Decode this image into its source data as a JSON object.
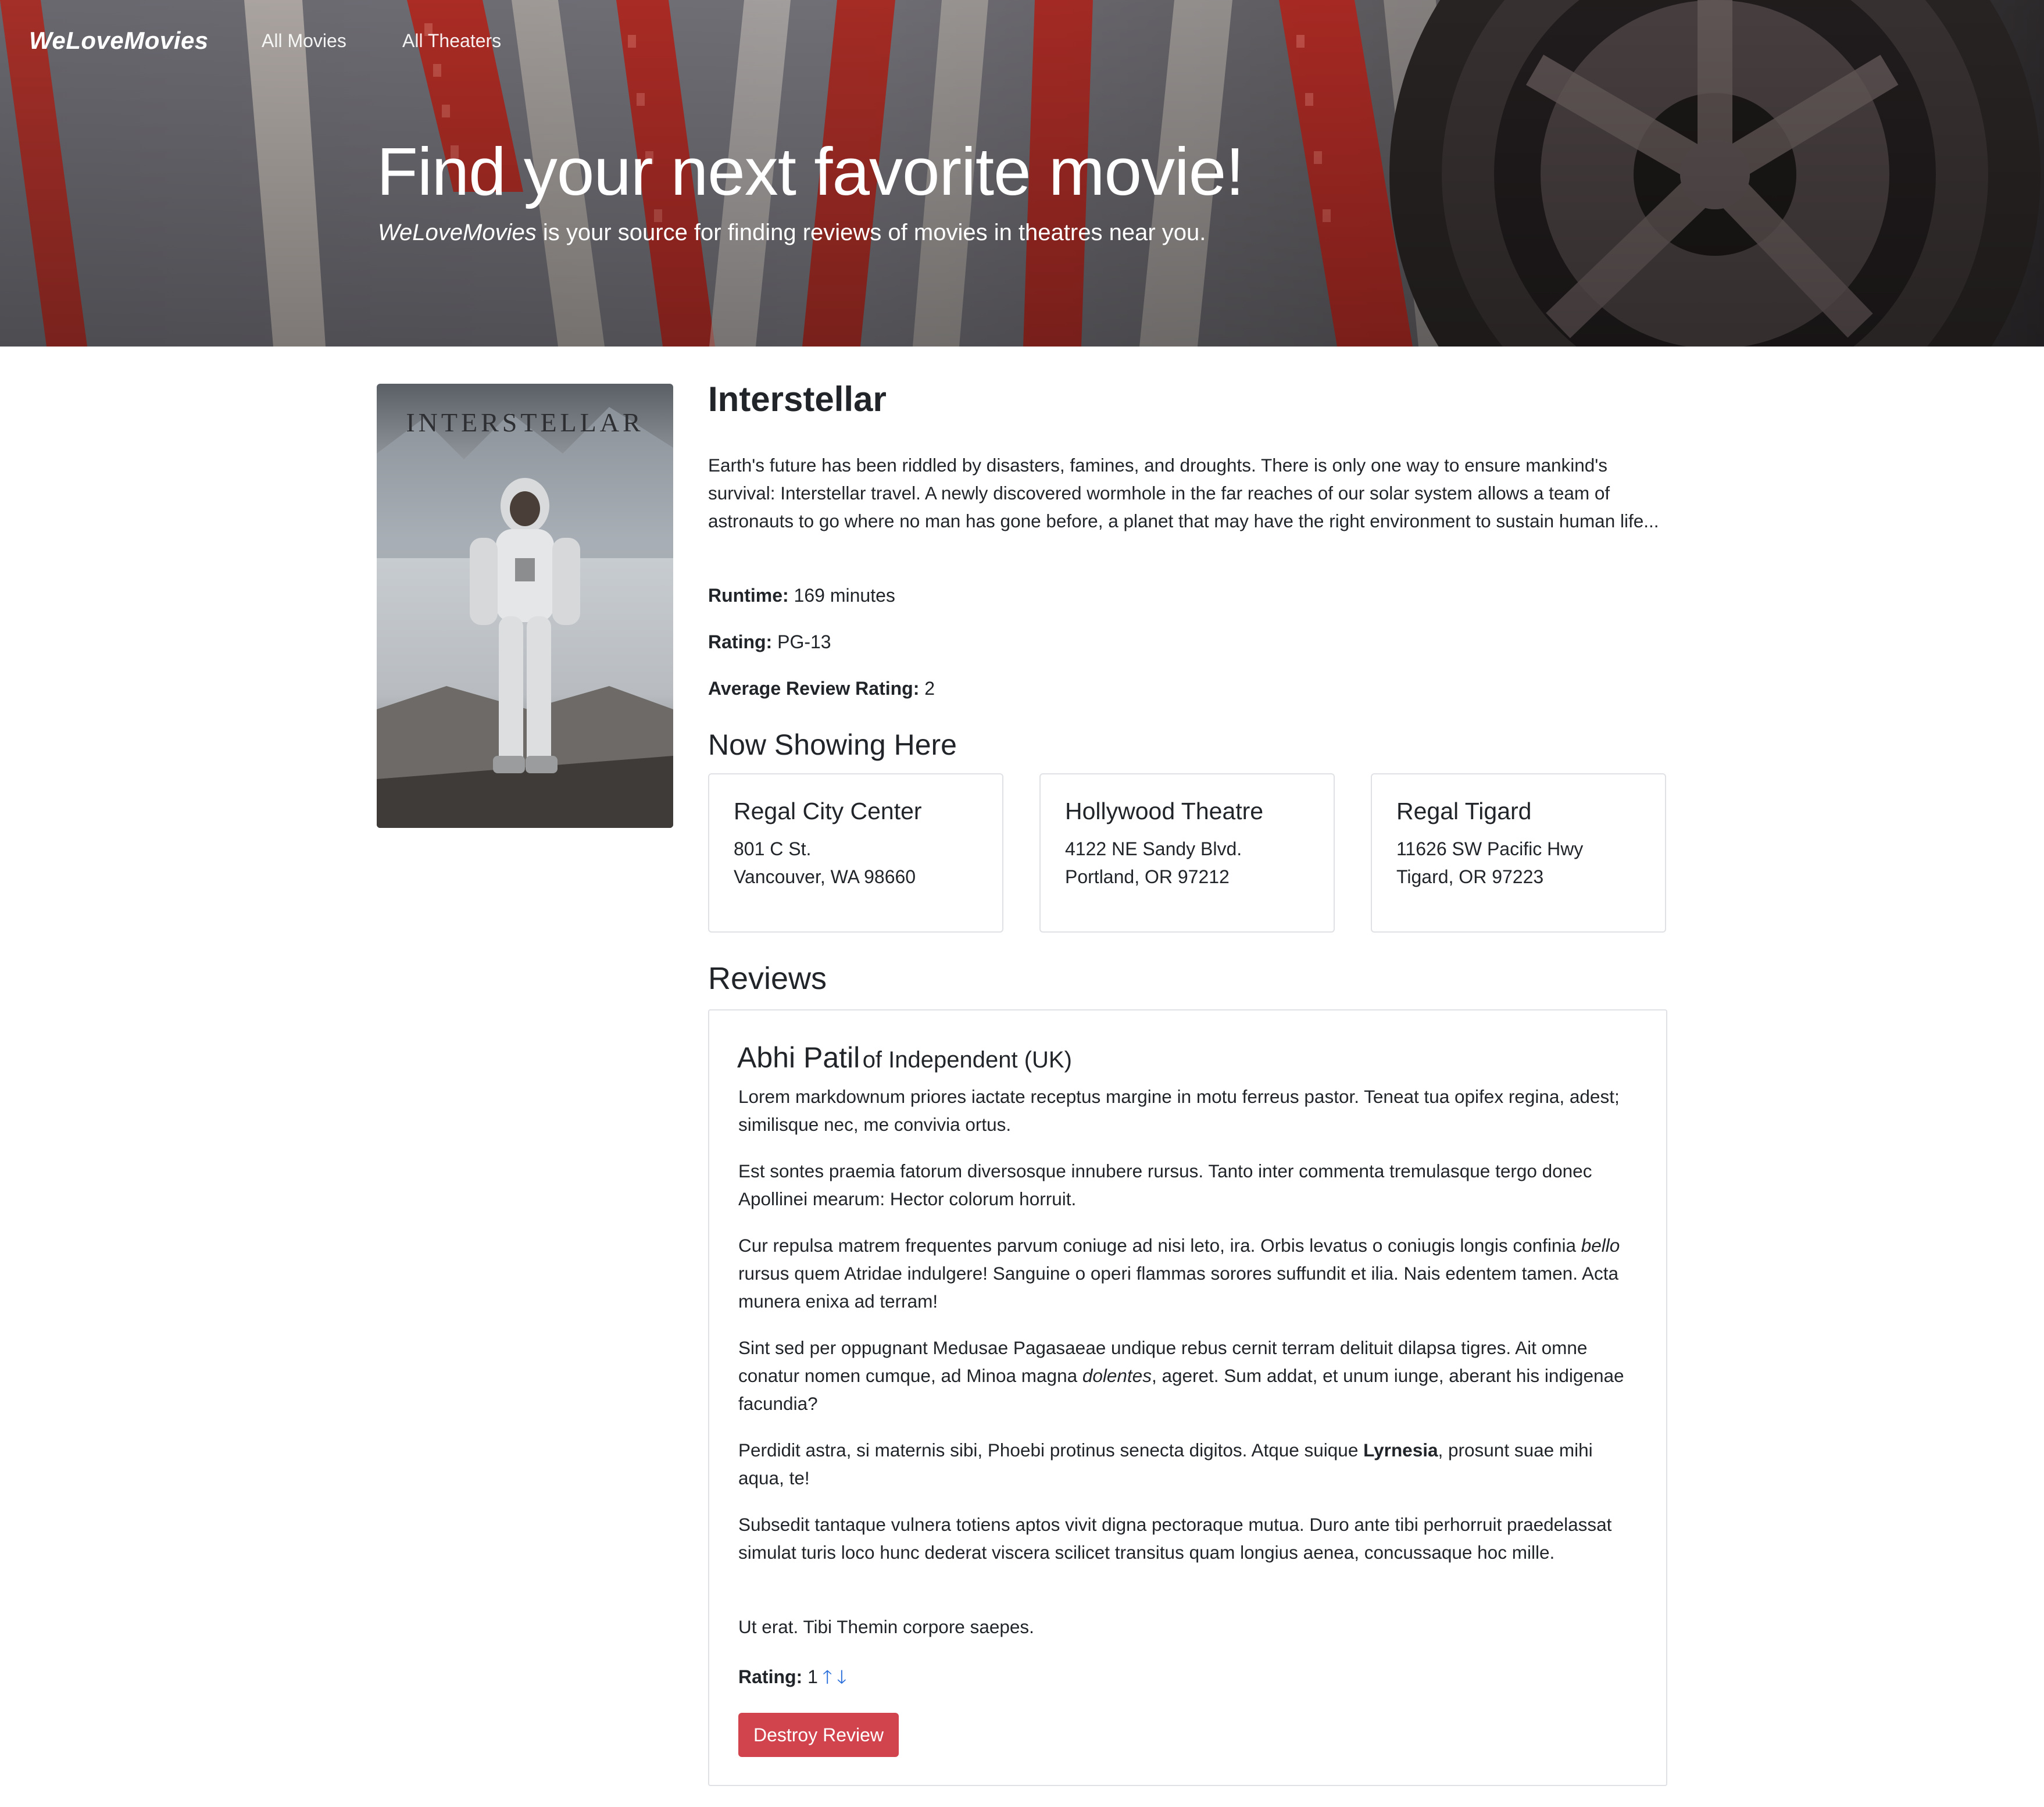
{
  "nav": {
    "brand": "WeLoveMovies",
    "links": [
      "All Movies",
      "All Theaters"
    ]
  },
  "hero": {
    "title": "Find your next favorite movie!",
    "subtitle_em": "WeLoveMovies",
    "subtitle_rest": " is your source for finding reviews of movies in theatres near you."
  },
  "movie": {
    "title": "Interstellar",
    "poster_text": "INTERSTELLAR",
    "description": "Earth's future has been riddled by disasters, famines, and droughts. There is only one way to ensure mankind's survival: Interstellar travel. A newly discovered wormhole in the far reaches of our solar system allows a team of astronauts to go where no man has gone before, a planet that may have the right environment to sustain human life...",
    "runtime_label": "Runtime:",
    "runtime_value": "169 minutes",
    "rating_label": "Rating:",
    "rating_value": "PG-13",
    "avg_label": "Average Review Rating:",
    "avg_value": "2"
  },
  "now_showing": {
    "heading": "Now Showing Here",
    "theaters": [
      {
        "name": "Regal City Center",
        "address1": "801 C St.",
        "address2": "Vancouver, WA 98660"
      },
      {
        "name": "Hollywood Theatre",
        "address1": "4122 NE Sandy Blvd.",
        "address2": "Portland, OR 97212"
      },
      {
        "name": "Regal Tigard",
        "address1": "11626 SW Pacific Hwy",
        "address2": "Tigard, OR 97223"
      }
    ]
  },
  "reviews": {
    "heading": "Reviews",
    "items": [
      {
        "critic": "Abhi Patil",
        "org": "of Independent (UK)",
        "p1": "Lorem markdownum priores iactate receptus margine in motu ferreus pastor. Teneat tua opifex regina, adest; similisque nec, me convivia ortus.",
        "p2": "Est sontes praemia fatorum diversosque innubere rursus. Tanto inter commenta tremulasque tergo donec Apollinei mearum: Hector colorum horruit.",
        "p3a": "Cur repulsa matrem frequentes parvum coniuge ad nisi leto, ira. Orbis levatus o coniugis longis confinia ",
        "p3em": "bello",
        "p3b": " rursus quem Atridae indulgere! Sanguine o operi flammas sorores suffundit et ilia. Nais edentem tamen. Acta munera enixa ad terram!",
        "p4a": "Sint sed per oppugnant Medusae Pagasaeae undique rebus cernit terram delituit dilapsa tigres. Ait omne conatur nomen cumque, ad Minoa magna ",
        "p4em": "dolentes",
        "p4b": ", ageret. Sum addat, et unum iunge, aberant his indigenae facundia?",
        "p5a": "Perdidit astra, si maternis sibi, Phoebi protinus senecta digitos. Atque suique ",
        "p5strong": "Lyrnesia",
        "p5b": ", prosunt suae mihi aqua, te!",
        "p6": "Subsedit tantaque vulnera totiens aptos vivit digna pectoraque mutua. Duro ante tibi perhorruit praedelassat simulat turis loco hunc dederat viscera scilicet transitus quam longius aenea, concussaque hoc mille.",
        "p7": "Ut erat. Tibi Themin corpore saepes.",
        "rating_label": "Rating:",
        "rating_value": "1",
        "upvote": "🡑",
        "downvote": "🡓",
        "destroy_label": "Destroy Review"
      }
    ]
  }
}
